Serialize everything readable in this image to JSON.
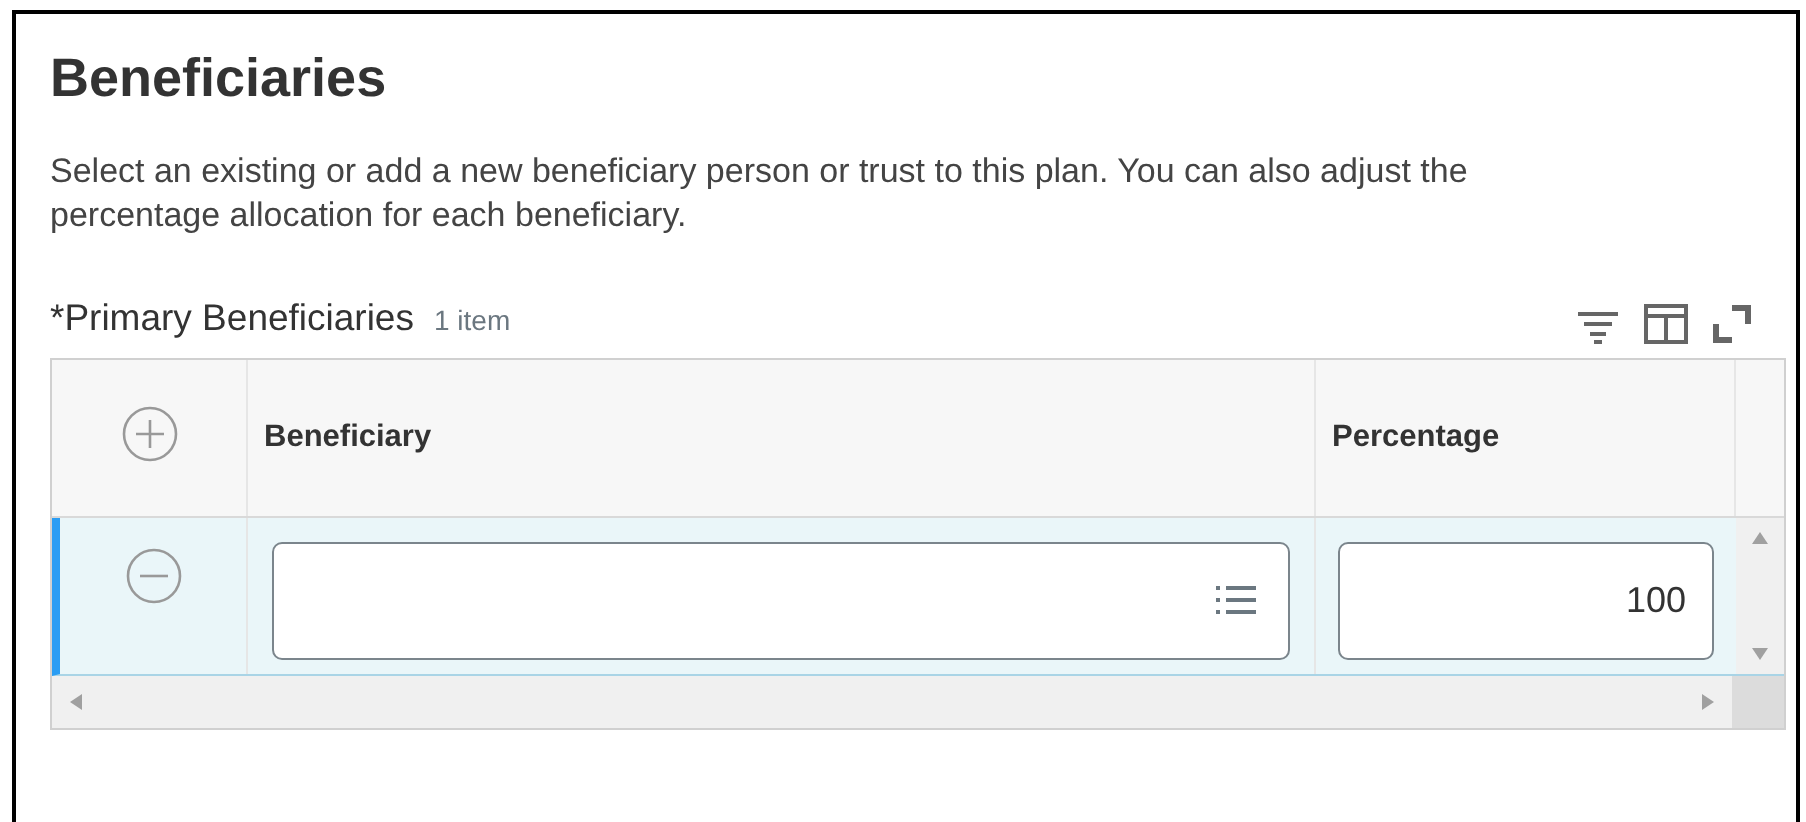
{
  "title": "Beneficiaries",
  "description": "Select an existing or add a new beneficiary person or trust to this plan. You can also adjust the percentage allocation for each beneficiary.",
  "grid": {
    "title": "*Primary Beneficiaries",
    "count": "1 item",
    "columns": [
      "Beneficiary",
      "Percentage"
    ],
    "rows": [
      {
        "beneficiary": "",
        "percentage": "100",
        "selected": true
      }
    ]
  }
}
